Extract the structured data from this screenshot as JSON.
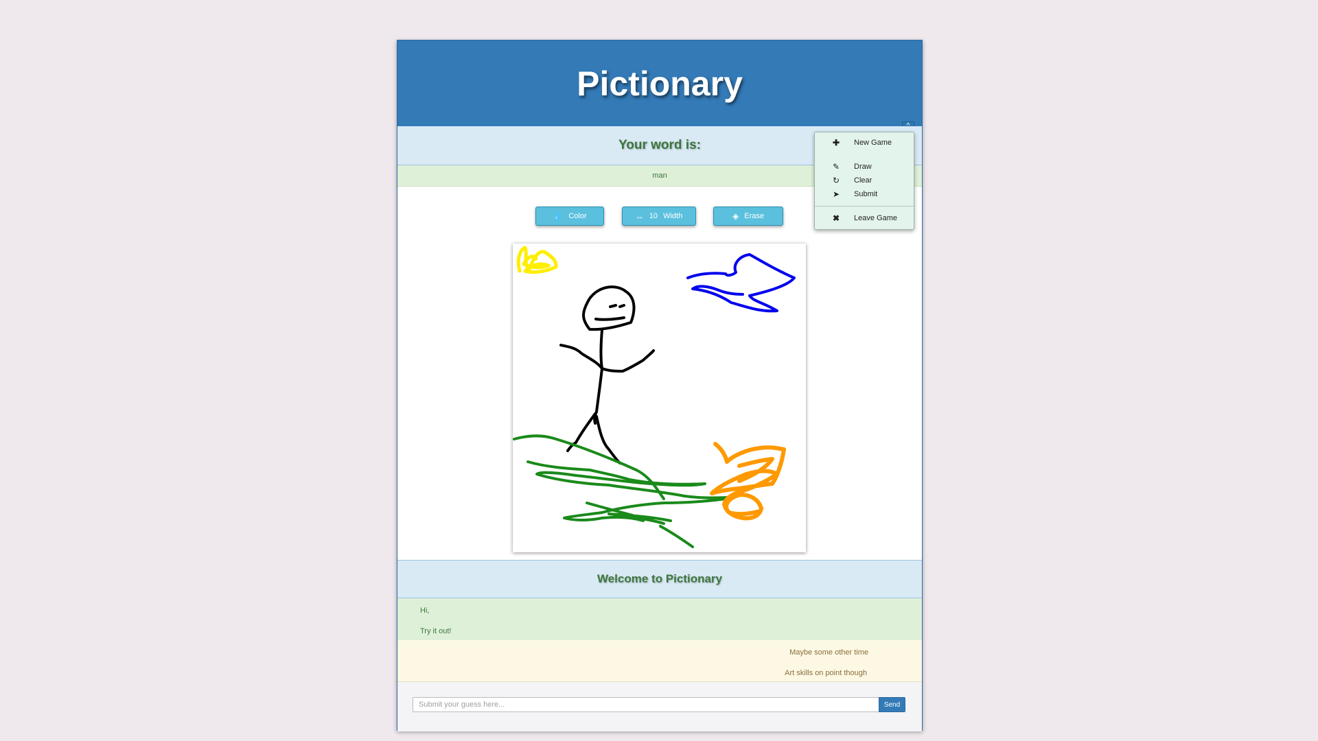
{
  "app": {
    "title": "Pictionary"
  },
  "word_panel": {
    "heading": "Your word is:",
    "word": "man"
  },
  "toolbar": {
    "color_label": "Color",
    "width_value": "10",
    "width_label": "Width",
    "erase_label": "Erase"
  },
  "canvas": {
    "strokes": [
      {
        "color": "#ffee00",
        "name": "yellow-stroke"
      },
      {
        "color": "#0000ee",
        "name": "blue-stroke"
      },
      {
        "color": "#000000",
        "name": "black-stroke"
      },
      {
        "color": "#1a8a1a",
        "name": "green-stroke"
      },
      {
        "color": "#ff9900",
        "name": "orange-stroke"
      }
    ]
  },
  "chat": {
    "heading": "Welcome to Pictionary",
    "messages_self": [
      "Hi,",
      "Try it out!"
    ],
    "messages_other": [
      "Maybe some other time",
      "Art skills on point though"
    ],
    "input_placeholder": "Submit your guess here...",
    "send_label": "Send"
  },
  "menu": {
    "items": [
      {
        "label": "New Game",
        "icon": "plus-icon"
      },
      {
        "label": "Draw",
        "icon": "pencil-icon"
      },
      {
        "label": "Clear",
        "icon": "refresh-icon"
      },
      {
        "label": "Submit",
        "icon": "send-icon"
      },
      {
        "label": "Leave Game",
        "icon": "close-icon"
      }
    ]
  }
}
